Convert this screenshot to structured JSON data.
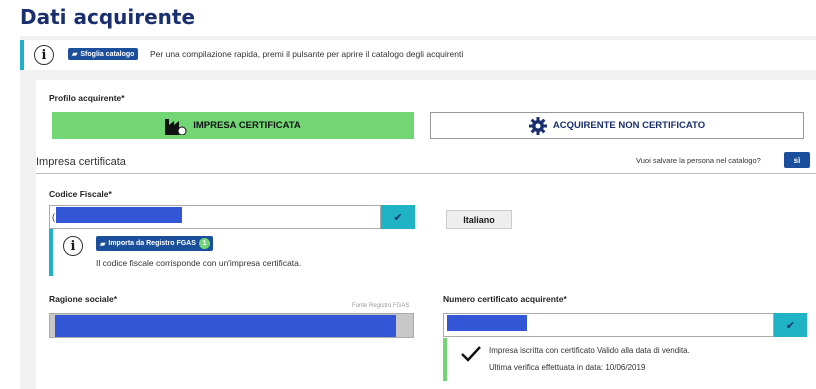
{
  "page_title": "Dati acquirente",
  "catalog_info": {
    "button_label": "Sfoglia catalogo",
    "text": "Per una compilazione rapida, premi il pulsante per aprire il catalogo degli acquirenti"
  },
  "profile": {
    "label": "Profilo acquirente*",
    "option_certified": "IMPRESA CERTIFICATA",
    "option_not_certified": "ACQUIRENTE NON CERTIFICATO",
    "selected": "IMPRESA CERTIFICATA"
  },
  "section": {
    "title": "Impresa certificata",
    "save_question": "Vuoi salvare la persona nel catalogo?",
    "save_toggle": "sì"
  },
  "codice_fiscale": {
    "label": "Codice Fiscale*",
    "value_prefix": "("
  },
  "language_button": "Italiano",
  "fgas_info": {
    "button_label": "Importa da Registro FGAS",
    "badge_count": "1",
    "text": "Il codice fiscale corrisponde con un'impresa certificata."
  },
  "ragione_sociale": {
    "label": "Ragione sociale*",
    "source": "Fonte Registro FGAS"
  },
  "numero_certificato": {
    "label": "Numero certificato acquirente*"
  },
  "validation": {
    "line1": "Impresa iscritta con certificato Valido alla data di vendita.",
    "line2": "Ultima verifica effettuata in data: 10/06/2019"
  },
  "icons": {
    "info": "info-circle-icon",
    "book": "book-icon",
    "factory": "factory-icon",
    "gear": "gear-icon",
    "check": "check-icon"
  },
  "colors": {
    "title": "#1b2f6e",
    "accent_teal": "#1fb3c5",
    "selected_green": "#72d675",
    "button_blue": "#1b4f9c",
    "redaction_blue": "#3256d6"
  }
}
